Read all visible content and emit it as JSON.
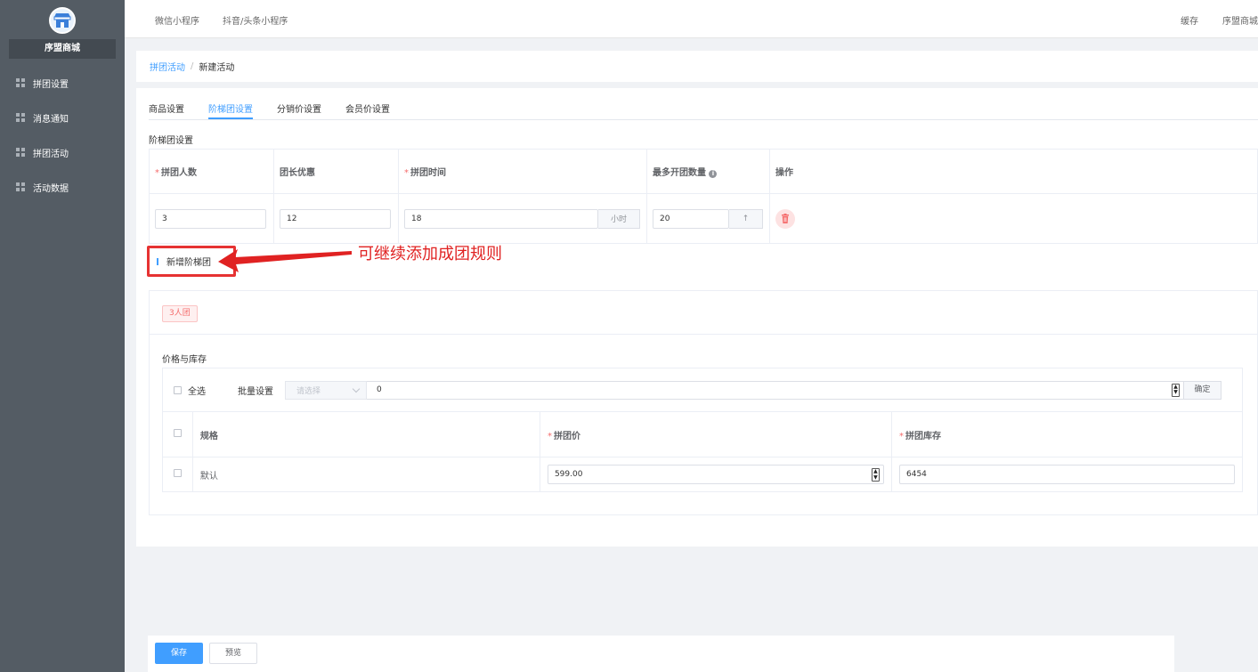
{
  "sidebar": {
    "store_name": "序盟商城",
    "items": [
      {
        "label": "拼团设置",
        "icon": "grid-icon"
      },
      {
        "label": "消息通知",
        "icon": "grid-icon"
      },
      {
        "label": "拼团活动",
        "icon": "grid-icon"
      },
      {
        "label": "活动数据",
        "icon": "grid-icon"
      }
    ]
  },
  "topbar": {
    "tabs": [
      "微信小程序",
      "抖音/头条小程序"
    ],
    "cache_label": "缓存",
    "store_label": "序盟商城"
  },
  "breadcrumb": {
    "parent": "拼团活动",
    "separator": "/",
    "current": "新建活动"
  },
  "tabs": [
    {
      "label": "商品设置",
      "active": false
    },
    {
      "label": "阶梯团设置",
      "active": true
    },
    {
      "label": "分销价设置",
      "active": false
    },
    {
      "label": "会员价设置",
      "active": false
    }
  ],
  "tier_section": {
    "title": "阶梯团设置",
    "columns": [
      "拼团人数",
      "团长优惠",
      "拼团时间",
      "最多开团数量",
      "操作"
    ],
    "row": {
      "people": "3",
      "leader_discount": "12",
      "time": "18",
      "time_unit": "小时",
      "max_groups": "20",
      "stepper_up": "↑"
    },
    "add_button": "新增阶梯团",
    "annotation": "可继续添加成团规则"
  },
  "group_card": {
    "tag": "3人团",
    "section_title": "价格与库存",
    "select_all": "全选",
    "batch_label": "批量设置",
    "batch_select_placeholder": "请选择",
    "batch_value": "0",
    "confirm": "确定",
    "columns": [
      "规格",
      "拼团价",
      "拼团库存"
    ],
    "rows": [
      {
        "spec": "默认",
        "price": "599.00",
        "stock": "6454"
      }
    ]
  },
  "footer": {
    "save": "保存",
    "preview": "预览"
  },
  "colors": {
    "primary": "#409eff",
    "danger": "#f56c6c",
    "sidebar": "#545c64",
    "annotation": "#e02222"
  }
}
